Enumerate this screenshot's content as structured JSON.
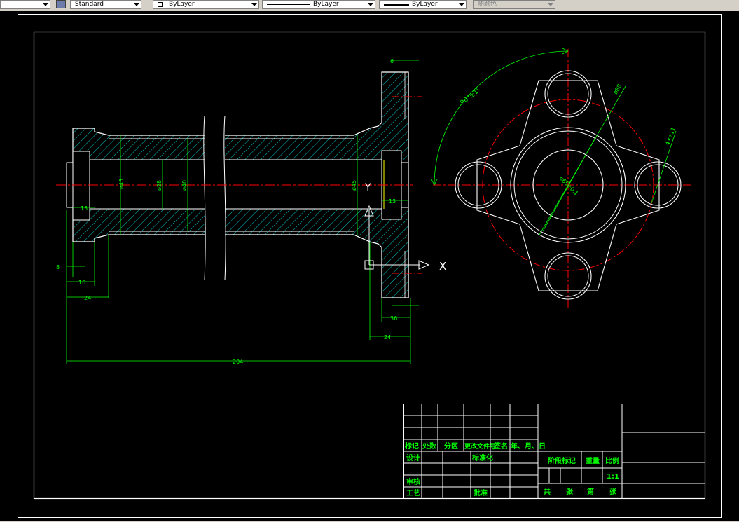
{
  "toolbar": {
    "dimstyle_value": "Standard",
    "layer_value": "ByLayer",
    "linetype_value": "ByLayer",
    "lineweight_value": "ByLayer",
    "color_value": "随颜色"
  },
  "drawing": {
    "dims": {
      "dia_outer": "ø45",
      "dia_inner": "ø28",
      "dia_mid": "ø40",
      "dia_right": "ø45",
      "left_13": "13",
      "right_13": "13",
      "top_small": "6",
      "bottom_small": "8",
      "d16": "16",
      "d24": "24",
      "d36": "36",
      "d24b": "24",
      "d204": "204",
      "angle": "90°±1°",
      "dia_pitch": "ø88",
      "holes": "4×ø11",
      "hub": "ø65±0.1"
    },
    "ucs": {
      "x_label": "X",
      "y_label": "Y"
    }
  },
  "title_block": {
    "row_mark": [
      "标记",
      "处数",
      "分区",
      "更改文件号",
      "签名",
      "年、月、日"
    ],
    "design": "设计",
    "standardize": "标准化",
    "review": "审核",
    "process": "工艺",
    "approve": "批准",
    "stage_mark": "阶段标记",
    "weight": "重量",
    "scale": "比例",
    "scale_value": "1:1",
    "total": "共",
    "sheets1": "张",
    "page": "第",
    "sheets2": "张"
  },
  "colors": {
    "background": "#000000",
    "outline": "#ffffff",
    "dimension": "#00ff00",
    "hatch": "#00ffff",
    "center": "#ff0000",
    "text": "#ffff00"
  }
}
